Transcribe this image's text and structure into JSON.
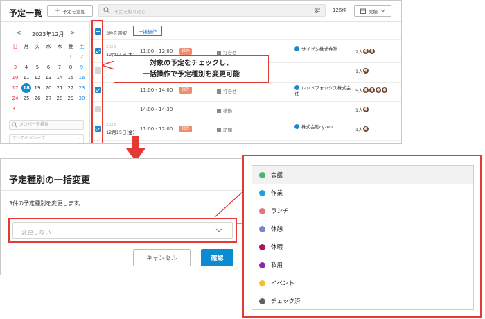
{
  "header": {
    "title": "予定一覧",
    "add_label": "予定を追加",
    "search_placeholder": "予定を絞り込む",
    "count": "126件",
    "view_label": "実績"
  },
  "calendar": {
    "month": "2023年12月",
    "weekdays": [
      "日",
      "月",
      "火",
      "水",
      "木",
      "金",
      "土"
    ],
    "rows": [
      [
        "",
        "",
        "",
        "",
        "",
        "1",
        "2"
      ],
      [
        "3",
        "4",
        "5",
        "6",
        "7",
        "8",
        "9"
      ],
      [
        "10",
        "11",
        "12",
        "13",
        "14",
        "15",
        "16"
      ],
      [
        "17",
        "18",
        "19",
        "20",
        "21",
        "22",
        "23"
      ],
      [
        "24",
        "25",
        "26",
        "27",
        "28",
        "29",
        "30"
      ],
      [
        "31",
        "",
        "",
        "",
        "",
        "",
        ""
      ]
    ],
    "today": "18",
    "member_search_placeholder": "メンバーを検索",
    "group_select": "すべてのグループ"
  },
  "list": {
    "selected_text": "3件を選択",
    "bulk_label": "一括操作",
    "rows": [
      {
        "checked": true,
        "year": "2023",
        "date": "12月14日(木)",
        "time": "11:00 - 12:00",
        "badge": "社外",
        "kind": "打合せ",
        "company": "サイゼン株式会社",
        "people": "2人",
        "avatars": 2
      },
      {
        "checked": false,
        "year": "",
        "date": "",
        "time": "",
        "badge": "",
        "kind": "",
        "company": "",
        "people": "1人",
        "avatars": 1
      },
      {
        "checked": true,
        "year": "",
        "date": "",
        "time": "11:00 - 14:00",
        "badge": "社外",
        "kind": "打合せ",
        "company": "レッドフォックス株式会社",
        "people": "5人",
        "avatars": 4
      },
      {
        "checked": false,
        "year": "",
        "date": "",
        "time": "14:00 - 14:30",
        "badge": "",
        "kind": "移動",
        "company": "",
        "people": "1人",
        "avatars": 1
      },
      {
        "checked": true,
        "year": "2023",
        "date": "12月15日(金)",
        "time": "11:00 - 12:00",
        "badge": "社外",
        "kind": "訪問",
        "company": "株式会社cyzen",
        "people": "1人",
        "avatars": 1
      }
    ]
  },
  "callout": {
    "line1": "対象の予定をチェックし、",
    "line2": "一括操作で予定種別を変更可能"
  },
  "dialog": {
    "title": "予定種別の一括変更",
    "text": "3件の予定種別を変更します。",
    "select_placeholder": "変更しない",
    "cancel_label": "キャンセル",
    "ok_label": "確認"
  },
  "dropdown": {
    "items": [
      {
        "label": "会議",
        "color": "#3dba6f"
      },
      {
        "label": "作業",
        "color": "#1e9fe0"
      },
      {
        "label": "ランチ",
        "color": "#e57373"
      },
      {
        "label": "休憩",
        "color": "#7986cb"
      },
      {
        "label": "休暇",
        "color": "#ad1457"
      },
      {
        "label": "私用",
        "color": "#8e24aa"
      },
      {
        "label": "イベント",
        "color": "#f6bf26"
      },
      {
        "label": "チェック済",
        "color": "#616161"
      }
    ],
    "highlighted": 0
  },
  "colors": {
    "accent": "#0d8bcf",
    "annotation": "#e53935",
    "badge": "#f28a6b"
  }
}
